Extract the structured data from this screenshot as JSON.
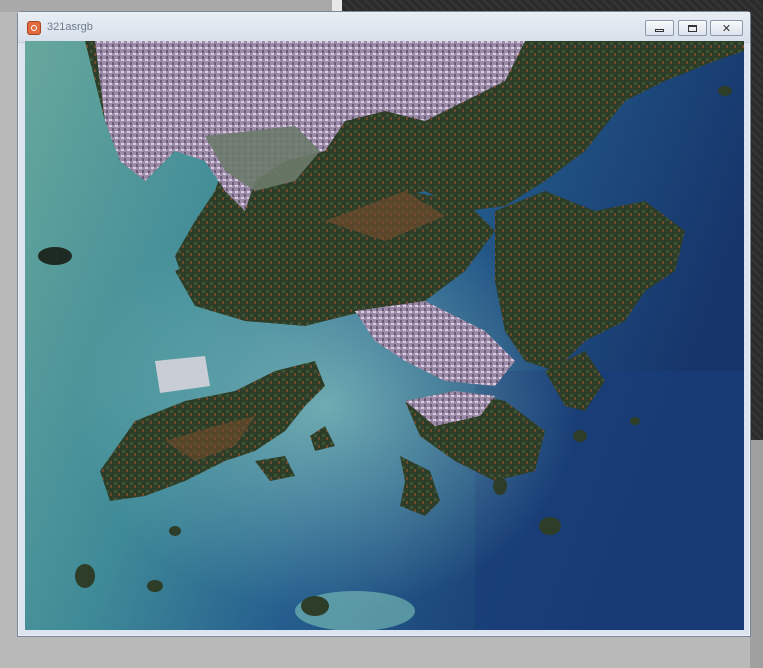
{
  "window": {
    "title": "321asrgb"
  },
  "icons": {
    "app": "app-logo-icon",
    "minimize": "minimize-icon",
    "restore": "restore-icon",
    "close": "close-icon"
  },
  "colors": {
    "sea_shallow": "#5fa29a",
    "sea_deep": "#173b73",
    "land_forest": "#2f3f2a",
    "urban": "#b9a7c2",
    "titlebar": "#dbe4ef"
  }
}
